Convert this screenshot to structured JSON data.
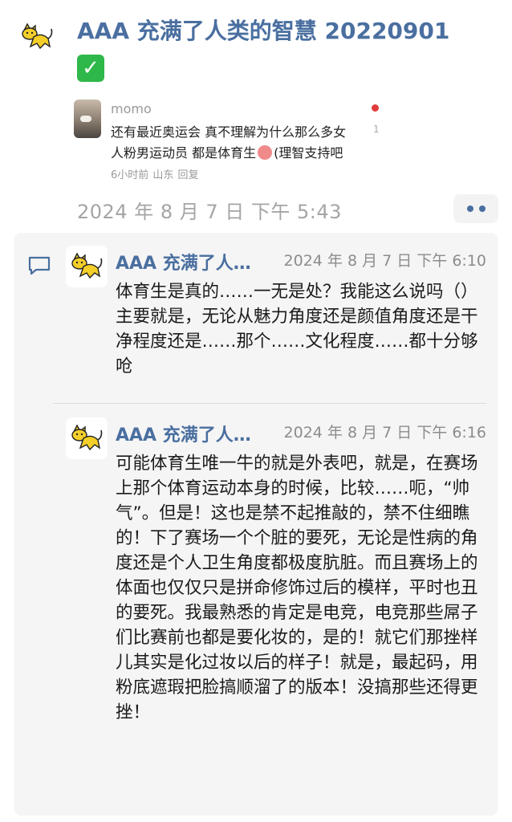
{
  "post": {
    "title": "AAA 充满了人类的智慧 20220901",
    "title_badge": "✓",
    "timestamp": "2024 年 8 月 7 日  下午 5:43"
  },
  "quoted_comment": {
    "username": "momo",
    "text": "还有最近奥运会 真不理解为什么那么多女人粉男运动员 都是体育生",
    "text_tail": "(理智支持吧",
    "time_ago": "6小时前",
    "location": "山东",
    "reply_label": "回复",
    "side_count": "1"
  },
  "comments": [
    {
      "author": "AAA 充满了人…",
      "timestamp": "2024 年 8 月 7 日  下午 6:10",
      "text": "体育生是真的……一无是处？我能这么说吗（）主要就是，无论从魅力角度还是颜值角度还是干净程度还是……那个……文化程度……都十分够呛"
    },
    {
      "author": "AAA 充满了人…",
      "timestamp": "2024 年 8 月 7 日  下午 6:16",
      "text": "可能体育生唯一牛的就是外表吧，就是，在赛场上那个体育运动本身的时候，比较……呃，“帅气”。但是！这也是禁不起推敲的，禁不住细瞧的！下了赛场一个个脏的要死，无论是性病的角度还是个人卫生角度都极度肮脏。而且赛场上的体面也仅仅只是拼命修饰过后的模样，平时也丑的要死。我最熟悉的肯定是电竞，电竞那些屌子们比赛前也都是要化妆的，是的！就它们那挫样儿其实是化过妆以后的样子！就是，最起码，用粉底遮瑕把脸搞顺溜了的版本！没搞那些还得更挫！"
    }
  ],
  "icons": {
    "avatar": "yellow-cat-icon",
    "comment": "comment-bubble-icon",
    "more": "more-dots-icon"
  },
  "colors": {
    "name_blue": "#4a6fa0",
    "badge_green": "#2eb84a",
    "panel_bg": "#f5f5f5"
  }
}
